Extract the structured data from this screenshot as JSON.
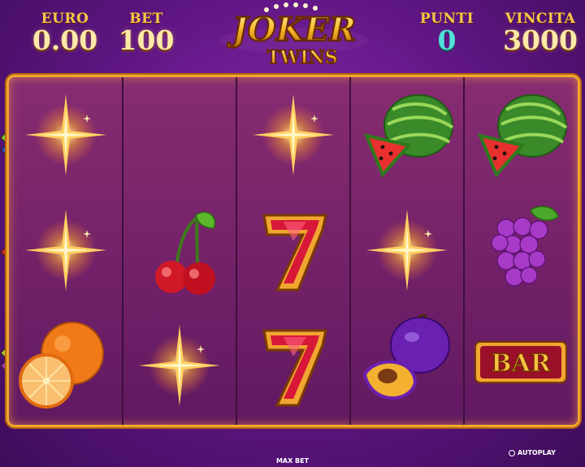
{
  "hud": {
    "euro_label": "EURO",
    "euro_value": "0.00",
    "bet_label": "BET",
    "bet_value": "100",
    "punti_label": "PUNTI",
    "punti_value": "0",
    "vincita_label": "VINCITA",
    "vincita_value": "3000"
  },
  "logo": {
    "line1": "JOKER",
    "line2": "TWINS"
  },
  "reels": [
    [
      "sparkle",
      "sparkle",
      "orange"
    ],
    [
      "empty",
      "cherries",
      "sparkle"
    ],
    [
      "sparkle",
      "seven",
      "seven"
    ],
    [
      "watermelon",
      "sparkle",
      "plum"
    ],
    [
      "watermelon",
      "grapes",
      "bar"
    ]
  ],
  "symbols": {
    "bar_label": "BAR"
  },
  "controls": {
    "max_bet_label": "MAX BET",
    "autoplay_label": "AUTOPLAY"
  },
  "colors": {
    "gold": "#f5c84a",
    "cyan": "#52e0d8",
    "frame": "#f0a630",
    "background": "#5c1580"
  }
}
